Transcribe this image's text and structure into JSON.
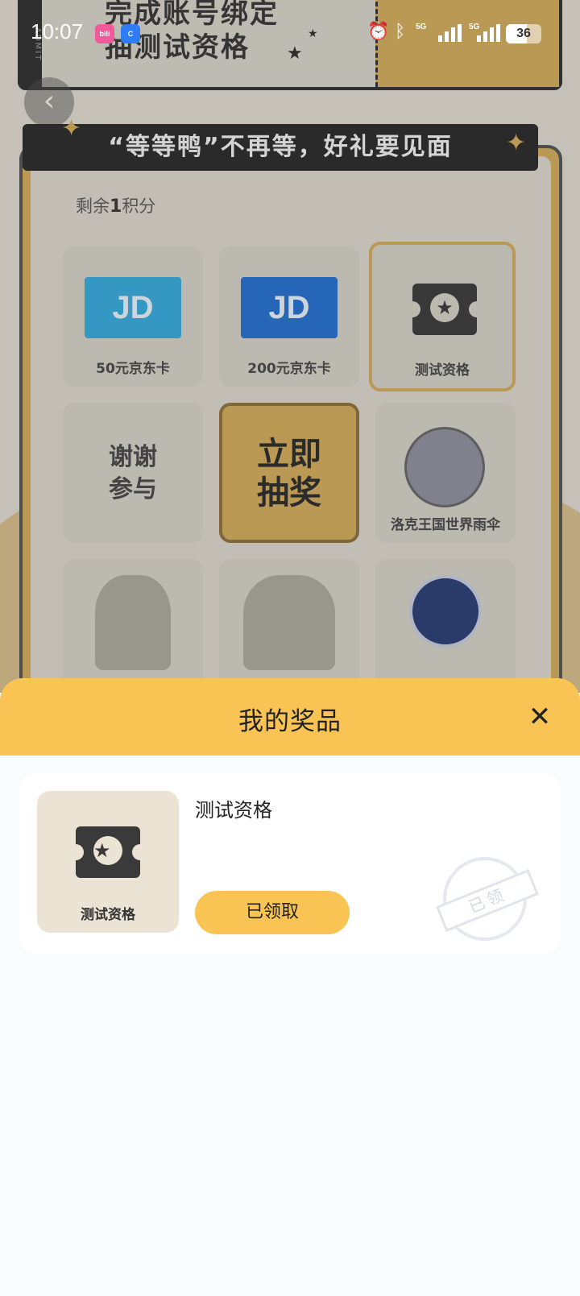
{
  "status_bar": {
    "time": "10:07",
    "signal_1": "5G",
    "signal_2": "5G",
    "battery": "36"
  },
  "background": {
    "ticket_text_line1": "完成账号绑定",
    "ticket_text_line2": "抽测试资格",
    "banner": "“等等鸭”不再等，好礼要见面",
    "points_prefix": "剩余",
    "points_value": "1",
    "points_suffix": "积分",
    "grid": [
      {
        "label": "50元京东卡",
        "card_color": "#3aa5d4"
      },
      {
        "label": "200元京东卡",
        "card_color": "#2a6fc9"
      },
      {
        "label": "测试资格"
      },
      {
        "label": "谢谢参与",
        "line1": "谢谢",
        "line2": "参与"
      },
      {
        "label": "立即抽奖",
        "line1": "立即",
        "line2": "抽奖"
      },
      {
        "label": "洛克王国世界雨伞"
      }
    ]
  },
  "sheet": {
    "title": "我的奖品",
    "prizes": [
      {
        "name": "测试资格",
        "thumb_label": "测试资格",
        "action_label": "已领取",
        "stamp_text": "已领"
      }
    ]
  },
  "colors": {
    "accent": "#f9c453",
    "sheet_bg": "#fbfcfe"
  }
}
